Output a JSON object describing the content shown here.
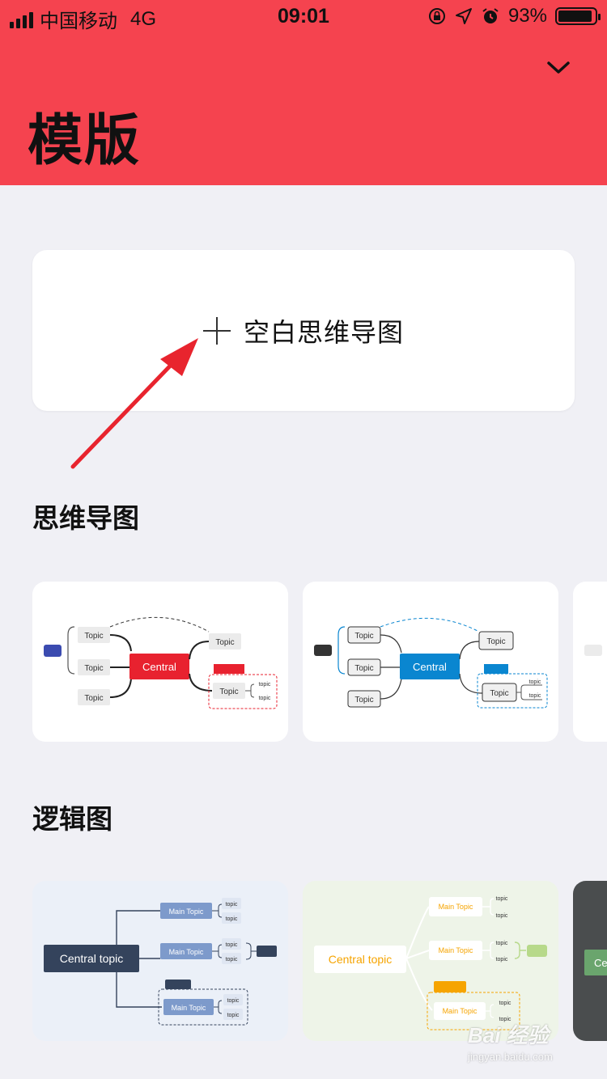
{
  "status_bar": {
    "carrier": "中国移动",
    "network": "4G",
    "time": "09:01",
    "battery_text": "93%",
    "battery_level": 0.93
  },
  "header": {
    "title": "模版",
    "bg_color": "#f5434f"
  },
  "blank_template": {
    "label": "空白思维导图"
  },
  "sections": [
    {
      "title": "思维导图",
      "cards": [
        {
          "central": "Central",
          "topic": "Topic",
          "subtopic": "topic",
          "accent": "#e8222f",
          "style": "red"
        },
        {
          "central": "Central",
          "topic": "Topic",
          "subtopic": "topic",
          "accent": "#0a86d0",
          "style": "blue"
        }
      ]
    },
    {
      "title": "逻辑图",
      "cards": [
        {
          "central": "Central topic",
          "main": "Main Topic",
          "subtopic": "topic",
          "accent": "#34435c",
          "style": "navy"
        },
        {
          "central": "Central topic",
          "main": "Main Topic",
          "subtopic": "topic",
          "accent": "#f6a400",
          "style": "amber"
        },
        {
          "central": "Ce",
          "accent": "#6aa56d",
          "style": "dark"
        }
      ]
    }
  ],
  "watermark": {
    "main": "Bai 经验",
    "sub": "jingyan.baidu.com"
  }
}
